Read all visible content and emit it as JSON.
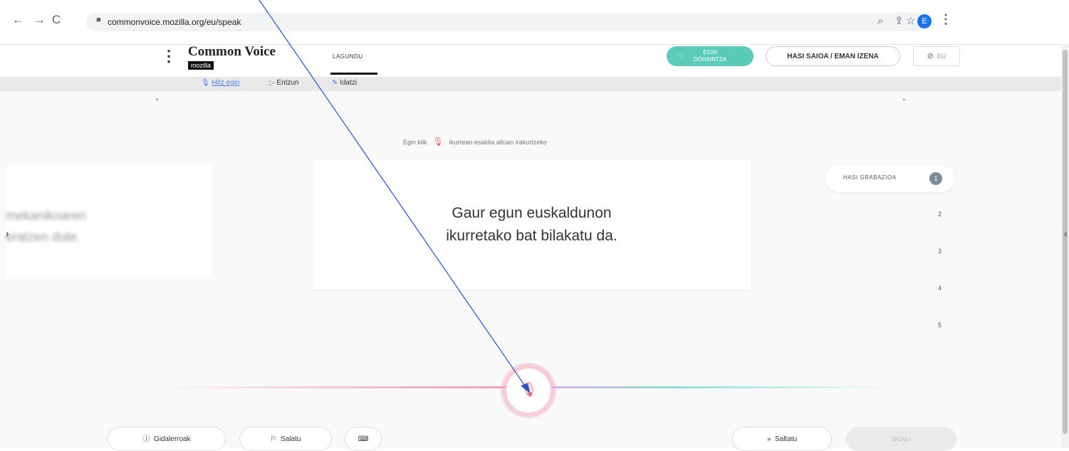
{
  "browser": {
    "url": "commonvoice.mozilla.org/eu/speak",
    "profile_initial": "E"
  },
  "header": {
    "brand": "Common Voice",
    "brand_sub": "mozilla",
    "nav_item": "LAGUNDU",
    "donate_line1": "EGIN",
    "donate_line2": "DOHAINTZA",
    "login": "HASI SAIOA / EMAN IZENA",
    "language": "EU"
  },
  "tabs": [
    {
      "label": "Hitz egin",
      "icon": "mic-icon",
      "color": "#4a7de0"
    },
    {
      "label": "Entzun",
      "icon": "play-icon",
      "color": "#4db6a4"
    },
    {
      "label": "Idatzi",
      "icon": "pencil-icon",
      "color": "#4a7de0"
    }
  ],
  "main": {
    "instruction_before": "Egin klik",
    "instruction_after": "ikurrean esaldia altuan irakurtzeko",
    "sentence_line1": "Gaur egun euskaldunon",
    "sentence_line2": "ikurretako bat bilakatu da.",
    "prev_line1": "mekanikoaren",
    "prev_line2": "eratzen dute."
  },
  "steps": {
    "label": "HASI GRABAZIOA",
    "numbers": [
      "1",
      "2",
      "3",
      "4",
      "5"
    ]
  },
  "footer": {
    "guidelines": "Gidalerroak",
    "report": "Salatu",
    "skip": "Saltatu",
    "send": "BIDALI"
  },
  "colors": {
    "accent_teal": "#59cbb7",
    "mic_red": "#f06070",
    "arrow_blue": "#2a4fc9"
  }
}
